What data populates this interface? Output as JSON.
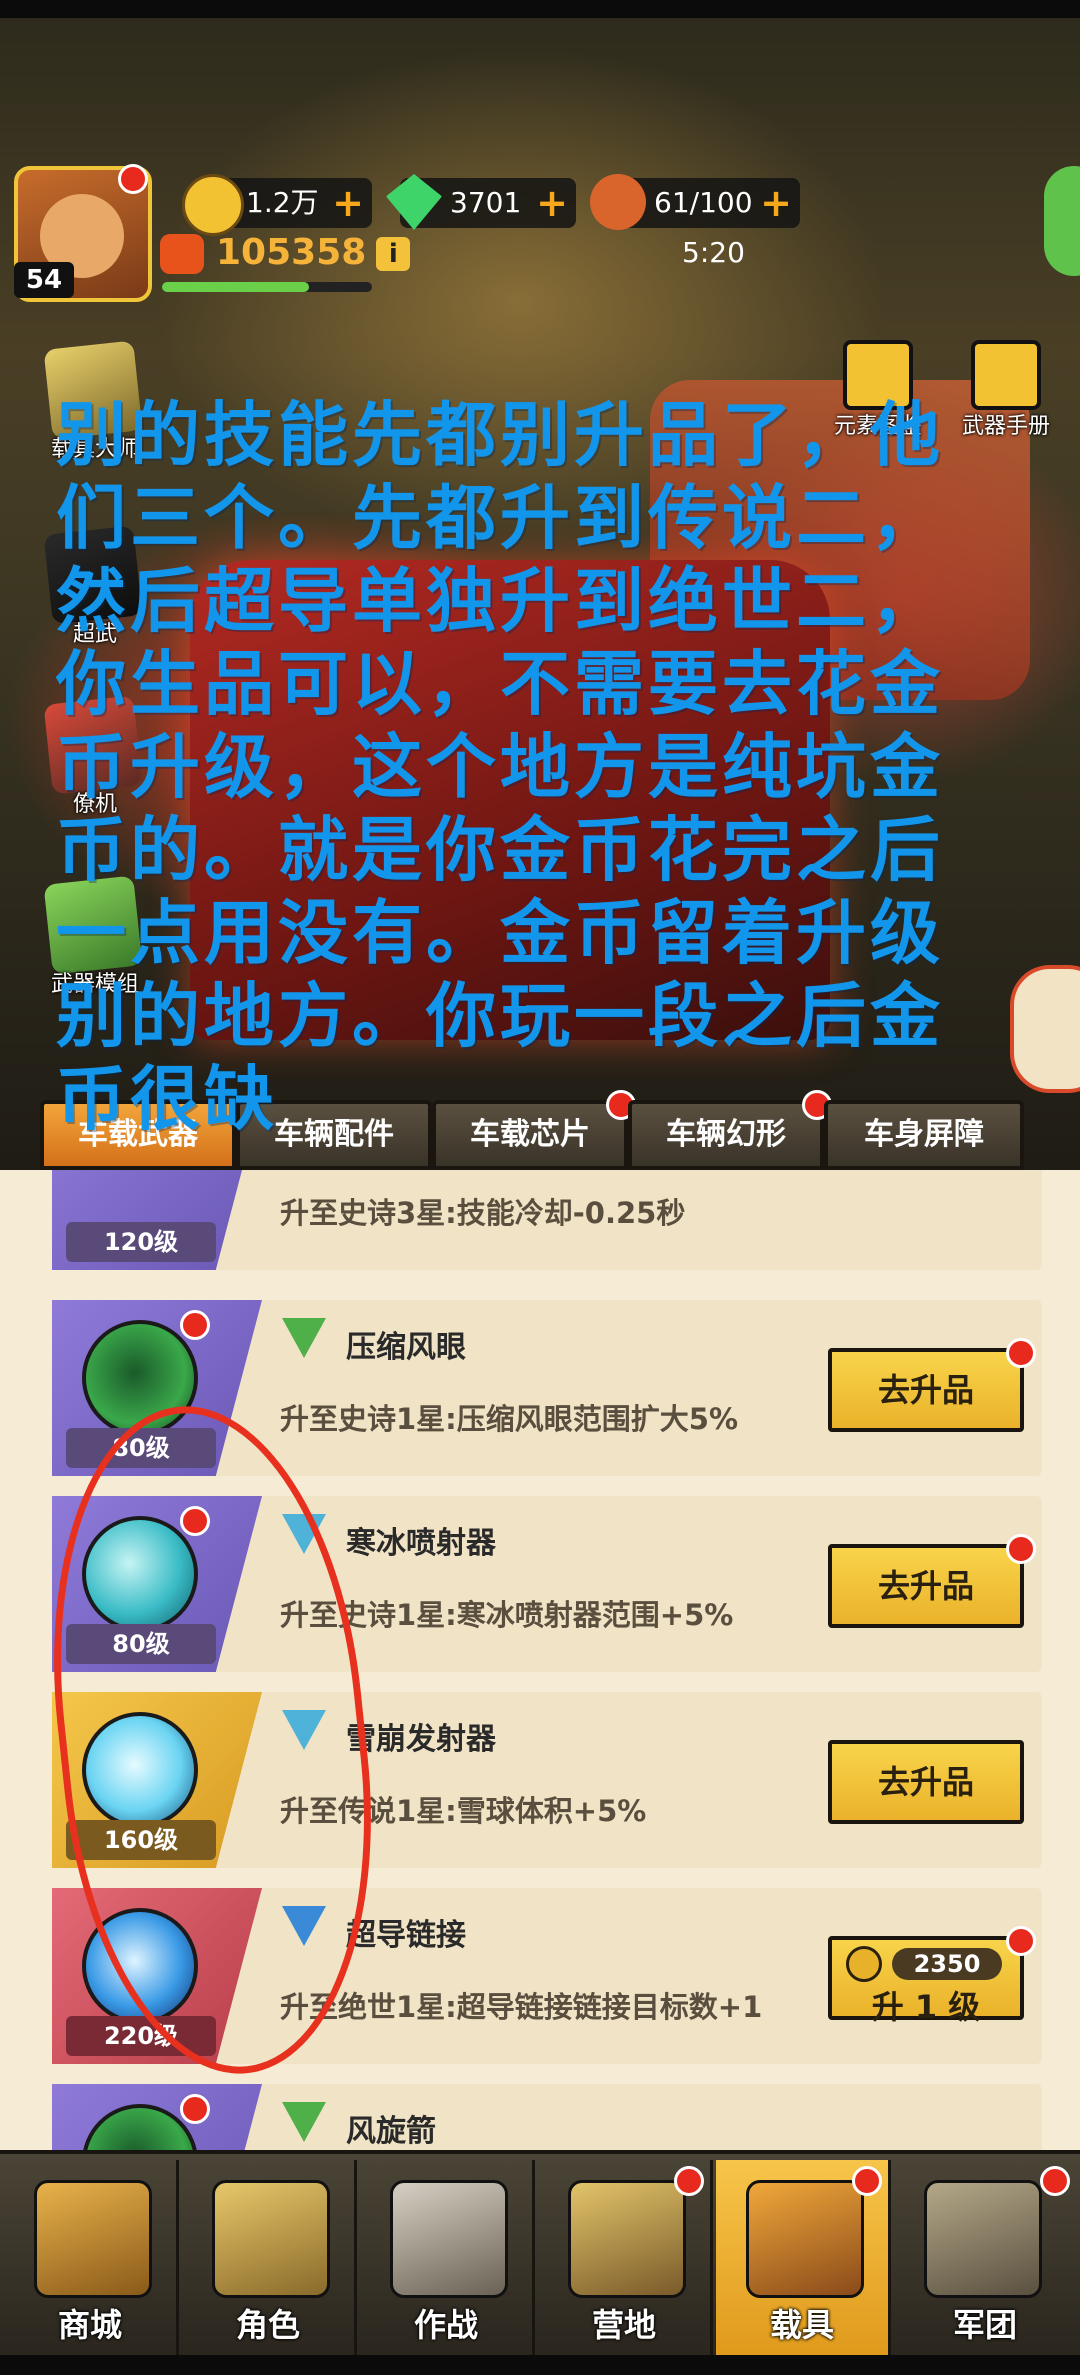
{
  "hud": {
    "level": "54",
    "gold": "1.2万",
    "gems": "3701",
    "stamina": "61/100",
    "plus": "+",
    "power": "105358",
    "info": "i",
    "timer": "5:20"
  },
  "left_menu": [
    {
      "label": "载具大师"
    },
    {
      "label": "超武"
    },
    {
      "label": "僚机"
    },
    {
      "label": "武器模组"
    }
  ],
  "right_menu": [
    {
      "label": "元素图鉴"
    },
    {
      "label": "武器手册"
    }
  ],
  "overlay_text": "别的技能先都别升品了，他们三个。先都升到传说二，然后超导单独升到绝世二，你生品可以，不需要去花金币升级，这个地方是纯坑金币的。就是你金币花完之后一点用没有。金币留着升级别的地方。你玩一段之后金币很缺",
  "tabs": [
    {
      "label": "车载武器",
      "active": true
    },
    {
      "label": "车辆配件"
    },
    {
      "label": "车载芯片"
    },
    {
      "label": "车辆幻形"
    },
    {
      "label": "车身屏障"
    }
  ],
  "items": [
    {
      "name": "",
      "level": "120级",
      "desc": "升至史诗3星:技能冷却-0.25秒",
      "button": ""
    },
    {
      "name": "压缩风眼",
      "level": "80级",
      "desc": "升至史诗1星:压缩风眼范围扩大5%",
      "button": "去升品"
    },
    {
      "name": "寒冰喷射器",
      "level": "80级",
      "desc": "升至史诗1星:寒冰喷射器范围+5%",
      "button": "去升品"
    },
    {
      "name": "雪崩发射器",
      "level": "160级",
      "desc": "升至传说1星:雪球体积+5%",
      "button": "去升品"
    },
    {
      "name": "超导链接",
      "level": "220级",
      "desc": "升至绝世1星:超导链接链接目标数+1",
      "cost": "2350",
      "button": "升 1 级"
    },
    {
      "name": "风旋箭",
      "level": "",
      "desc": "",
      "button": ""
    }
  ],
  "nav": [
    {
      "label": "商城"
    },
    {
      "label": "角色"
    },
    {
      "label": "作战"
    },
    {
      "label": "营地"
    },
    {
      "label": "载具",
      "active": true
    },
    {
      "label": "军团"
    }
  ],
  "colors": {
    "overlay_text": "#1296ec",
    "annotation_circle": "#e8301e",
    "button_gold": "#f8d44a",
    "notification_red": "#e82a1e"
  }
}
